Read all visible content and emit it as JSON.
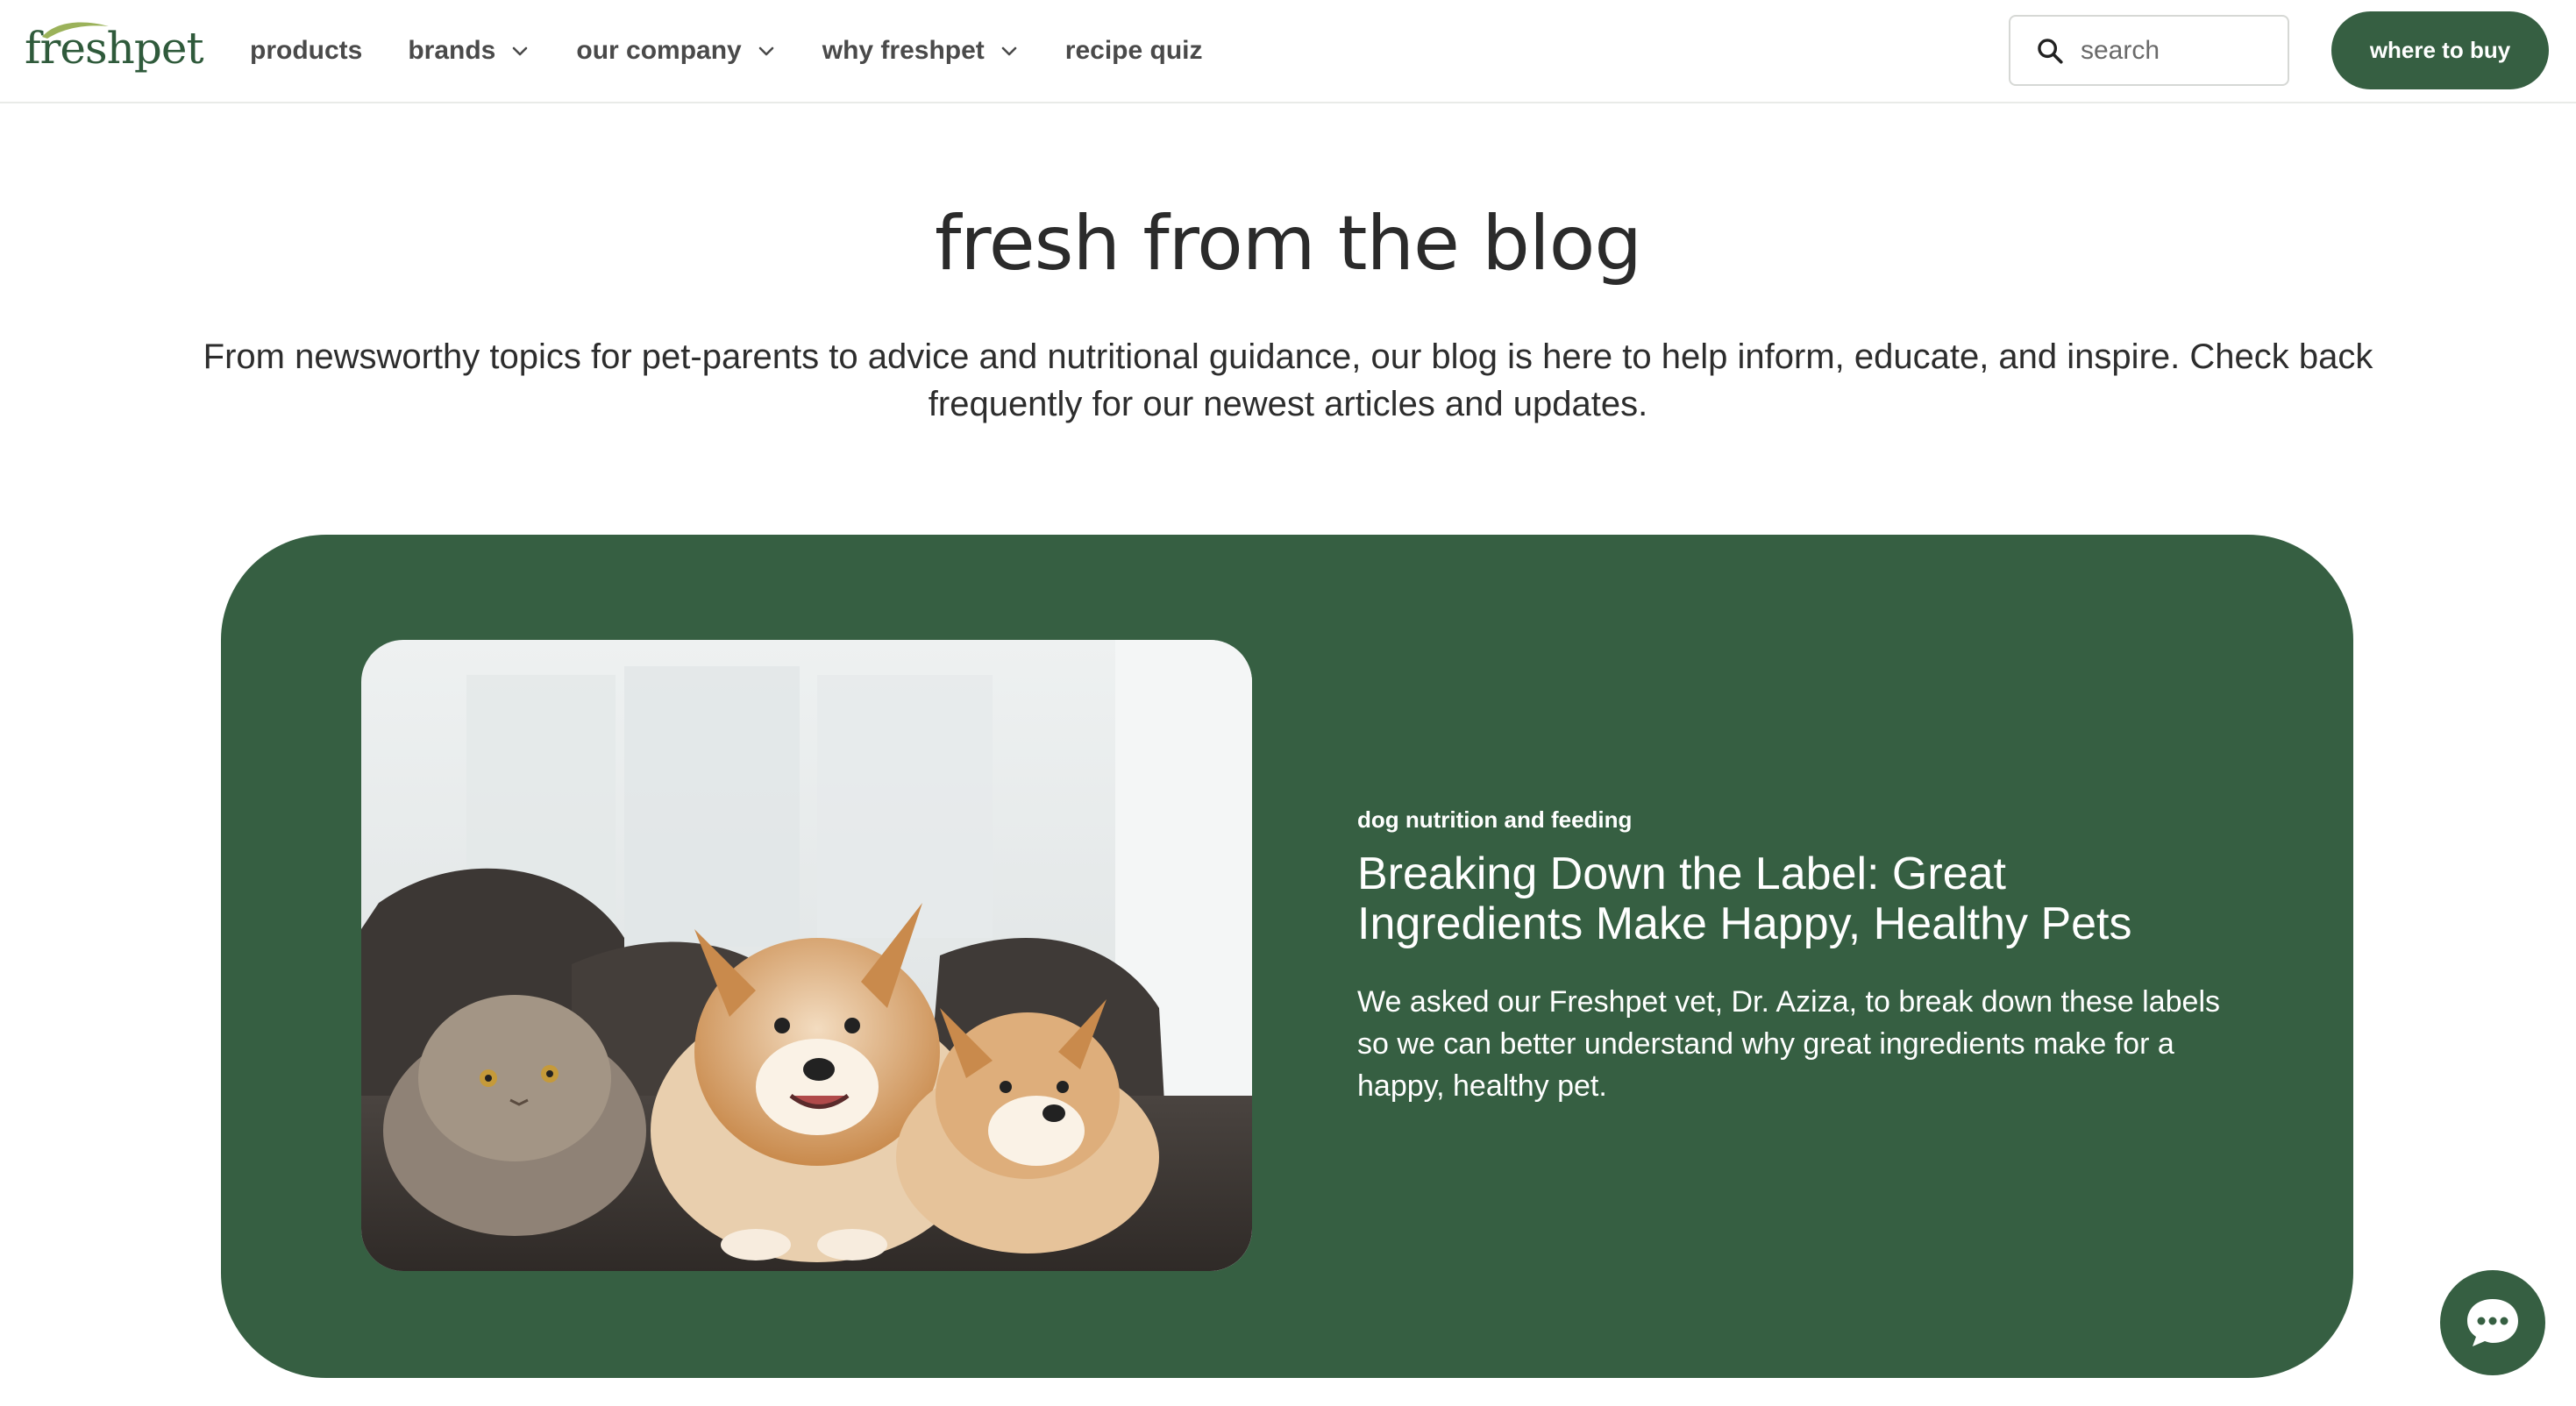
{
  "brand": {
    "name": "freshpet",
    "color": "#365f42"
  },
  "nav": {
    "items": [
      {
        "label": "products",
        "has_dropdown": false
      },
      {
        "label": "brands",
        "has_dropdown": true
      },
      {
        "label": "our company",
        "has_dropdown": true
      },
      {
        "label": "why freshpet",
        "has_dropdown": true
      },
      {
        "label": "recipe quiz",
        "has_dropdown": false
      }
    ]
  },
  "search": {
    "placeholder": "search",
    "icon": "search-icon"
  },
  "cta": {
    "label": "where to buy"
  },
  "page": {
    "title": "fresh from the blog",
    "intro": "From newsworthy topics for pet-parents to advice and nutritional guidance, our blog is here to help inform, educate, and inspire. Check back frequently for our newest articles and updates."
  },
  "featured": {
    "category": "dog nutrition and feeding",
    "title": "Breaking Down the Label: Great Ingredients Make Happy, Healthy Pets",
    "description": "We asked our Freshpet vet, Dr. Aziza, to break down these labels so we can better understand why great ingredients make for a happy, healthy pet.",
    "image_alt": "cat and two corgis on a sofa"
  },
  "chat": {
    "icon": "chat-icon"
  }
}
